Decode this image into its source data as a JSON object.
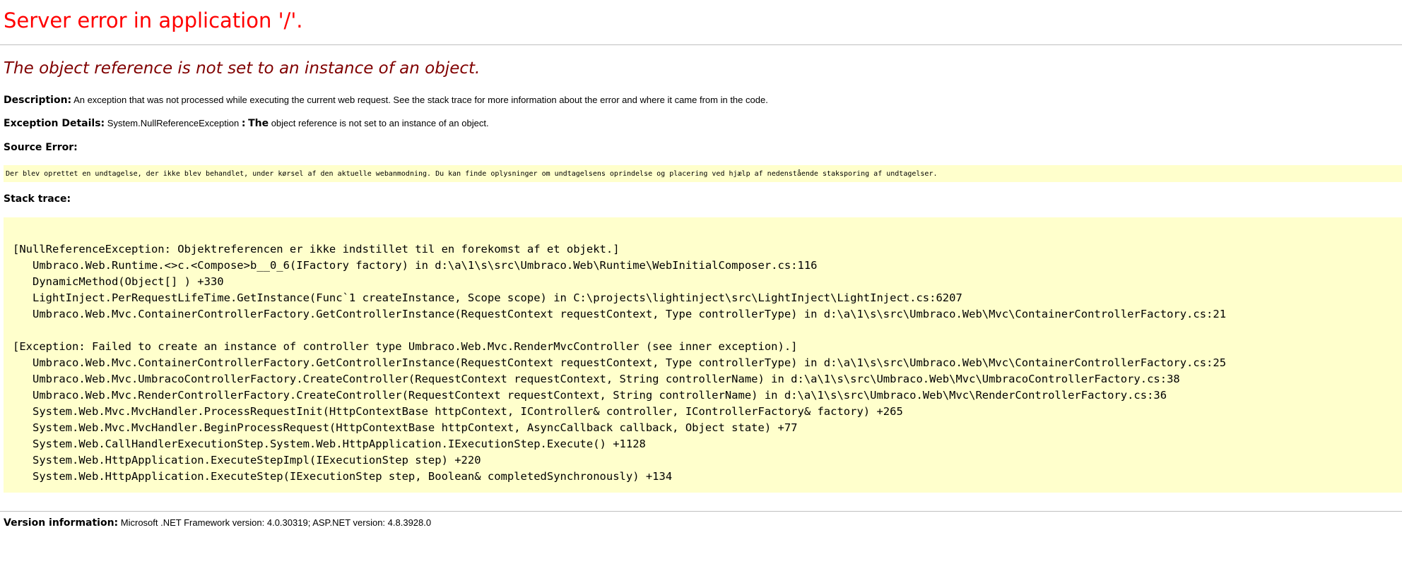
{
  "title": "Server error in application '/'.",
  "message": "The object reference is not set to an instance of an object.",
  "description": {
    "label": "Description:",
    "text": "An exception that was not processed while executing the current web request. See the stack trace for more information about the error and where it came from in the code."
  },
  "exception_details": {
    "label": "Exception Details:",
    "type": "System.NullReferenceException",
    "separator": ":",
    "the": "The",
    "text": "object reference is not set to an instance of an object."
  },
  "source_error": {
    "label": "Source Error:",
    "text": "Der blev oprettet en undtagelse, der ikke blev behandlet,  under kørsel af den aktuelle webanmodning. Du kan finde oplysninger om undtagelsens oprindelse og placering ved hjælp af nedenstående staksporing af undtagelser."
  },
  "stack_trace": {
    "label": "Stack trace:",
    "lines": [
      "[NullReferenceException: Objektreferencen er ikke indstillet til en forekomst af et objekt.]",
      "   Umbraco.Web.Runtime.<>c.<Compose>b__0_6(IFactory factory) in d:\\a\\1\\s\\src\\Umbraco.Web\\Runtime\\WebInitialComposer.cs:116",
      "   DynamicMethod(Object[] ) +330",
      "   LightInject.PerRequestLifeTime.GetInstance(Func`1 createInstance, Scope scope) in C:\\projects\\lightinject\\src\\LightInject\\LightInject.cs:6207",
      "   Umbraco.Web.Mvc.ContainerControllerFactory.GetControllerInstance(RequestContext requestContext, Type controllerType) in d:\\a\\1\\s\\src\\Umbraco.Web\\Mvc\\ContainerControllerFactory.cs:21",
      "",
      "[Exception: Failed to create an instance of controller type Umbraco.Web.Mvc.RenderMvcController (see inner exception).]",
      "   Umbraco.Web.Mvc.ContainerControllerFactory.GetControllerInstance(RequestContext requestContext, Type controllerType) in d:\\a\\1\\s\\src\\Umbraco.Web\\Mvc\\ContainerControllerFactory.cs:25",
      "   Umbraco.Web.Mvc.UmbracoControllerFactory.CreateController(RequestContext requestContext, String controllerName) in d:\\a\\1\\s\\src\\Umbraco.Web\\Mvc\\UmbracoControllerFactory.cs:38",
      "   Umbraco.Web.Mvc.RenderControllerFactory.CreateController(RequestContext requestContext, String controllerName) in d:\\a\\1\\s\\src\\Umbraco.Web\\Mvc\\RenderControllerFactory.cs:36",
      "   System.Web.Mvc.MvcHandler.ProcessRequestInit(HttpContextBase httpContext, IController& controller, IControllerFactory& factory) +265",
      "   System.Web.Mvc.MvcHandler.BeginProcessRequest(HttpContextBase httpContext, AsyncCallback callback, Object state) +77",
      "   System.Web.CallHandlerExecutionStep.System.Web.HttpApplication.IExecutionStep.Execute() +1128",
      "   System.Web.HttpApplication.ExecuteStepImpl(IExecutionStep step) +220",
      "   System.Web.HttpApplication.ExecuteStep(IExecutionStep step, Boolean& completedSynchronously) +134"
    ]
  },
  "version": {
    "label": "Version information:",
    "text": "Microsoft .NET Framework version: 4.0.30319; ASP.NET version: 4.8.3928.0"
  },
  "colors": {
    "title": "#ff0000",
    "message": "#800000",
    "box_background": "#ffffcc",
    "rule": "#c0c0c0"
  }
}
